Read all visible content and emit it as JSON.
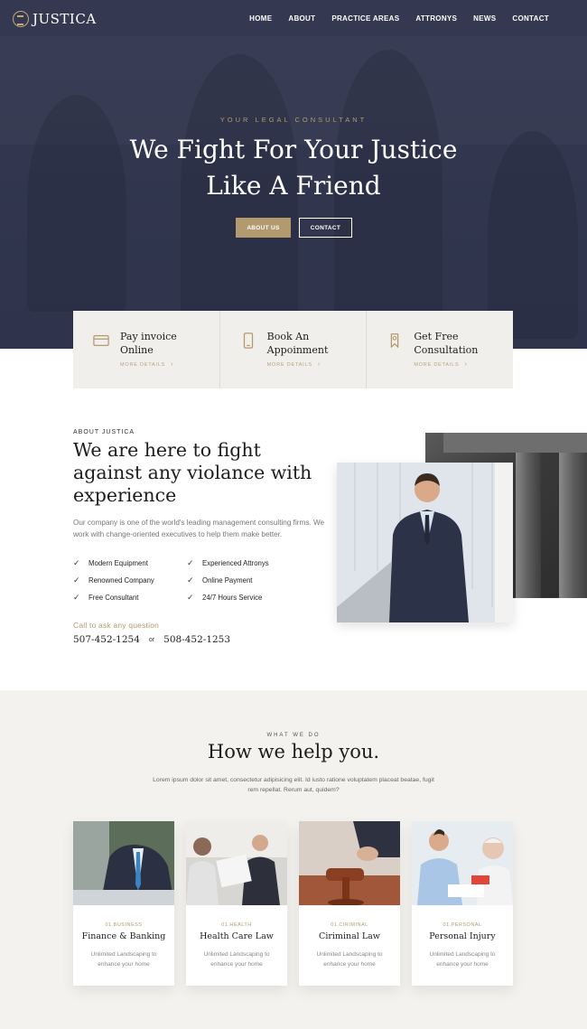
{
  "brand": {
    "name": "JUSTICA"
  },
  "nav": {
    "items": [
      "HOME",
      "ABOUT",
      "PRACTICE AREAS",
      "ATTRONYS",
      "NEWS",
      "CONTACT"
    ]
  },
  "hero": {
    "eyebrow": "YOUR LEGAL CONSULTANT",
    "title_line1": "We Fight For Your Justice",
    "title_line2": "Like A Friend",
    "primary_button": "ABOUT US",
    "secondary_button": "CONTACT"
  },
  "features": [
    {
      "icon": "credit-card-icon",
      "title_line1": "Pay invoice",
      "title_line2": "Online",
      "more": "MORE DETAILS"
    },
    {
      "icon": "mobile-phone-icon",
      "title_line1": "Book An",
      "title_line2": "Appoinment",
      "more": "MORE DETAILS"
    },
    {
      "icon": "ribbon-tag-icon",
      "title_line1": "Get Free",
      "title_line2": "Consultation",
      "more": "MORE DETAILS"
    }
  ],
  "about": {
    "eyebrow": "ABOUT JUSTICA",
    "title": "We are here to fight against any violance with experience",
    "text": "Our company is one of the world's leading management consulting firms. We work with change-oriented executives to help them make better.",
    "checks": [
      "Modern Equipment",
      "Experienced Attronys",
      "Renowned Company",
      "Online Payment",
      "Free Consultant",
      "24/7 Hours Service"
    ],
    "call_label": "Call to ask any question",
    "phone1": "507-452-1254",
    "or": "or",
    "phone2": "508-452-1253"
  },
  "help": {
    "eyebrow": "WHAT WE DO",
    "title": "How we help you.",
    "text": "Lorem ipsum dolor sit amet, consectetur adipisicing elit. Id iusto ratione voluptatem placeat beatae, fugit rem repellat. Rerum aut, quidem?",
    "practices": [
      {
        "tag": "01.BUSINESS",
        "name": "Finance & Banking",
        "desc": "Unlimited Landscaping to enhance your home"
      },
      {
        "tag": "01.HEALTH",
        "name": "Health Care Law",
        "desc": "Unlimited Landscaping to enhance your home"
      },
      {
        "tag": "01.CIRIMINAL",
        "name": "Ciriminal Law",
        "desc": "Unlimited Landscaping to enhance your home"
      },
      {
        "tag": "01.PERSONAL",
        "name": "Personal Injury",
        "desc": "Unlimited Landscaping to enhance your home"
      }
    ]
  },
  "colors": {
    "accent": "#b39a6e",
    "hero_overlay": "#343852",
    "section_bg": "#f4f2ee"
  }
}
